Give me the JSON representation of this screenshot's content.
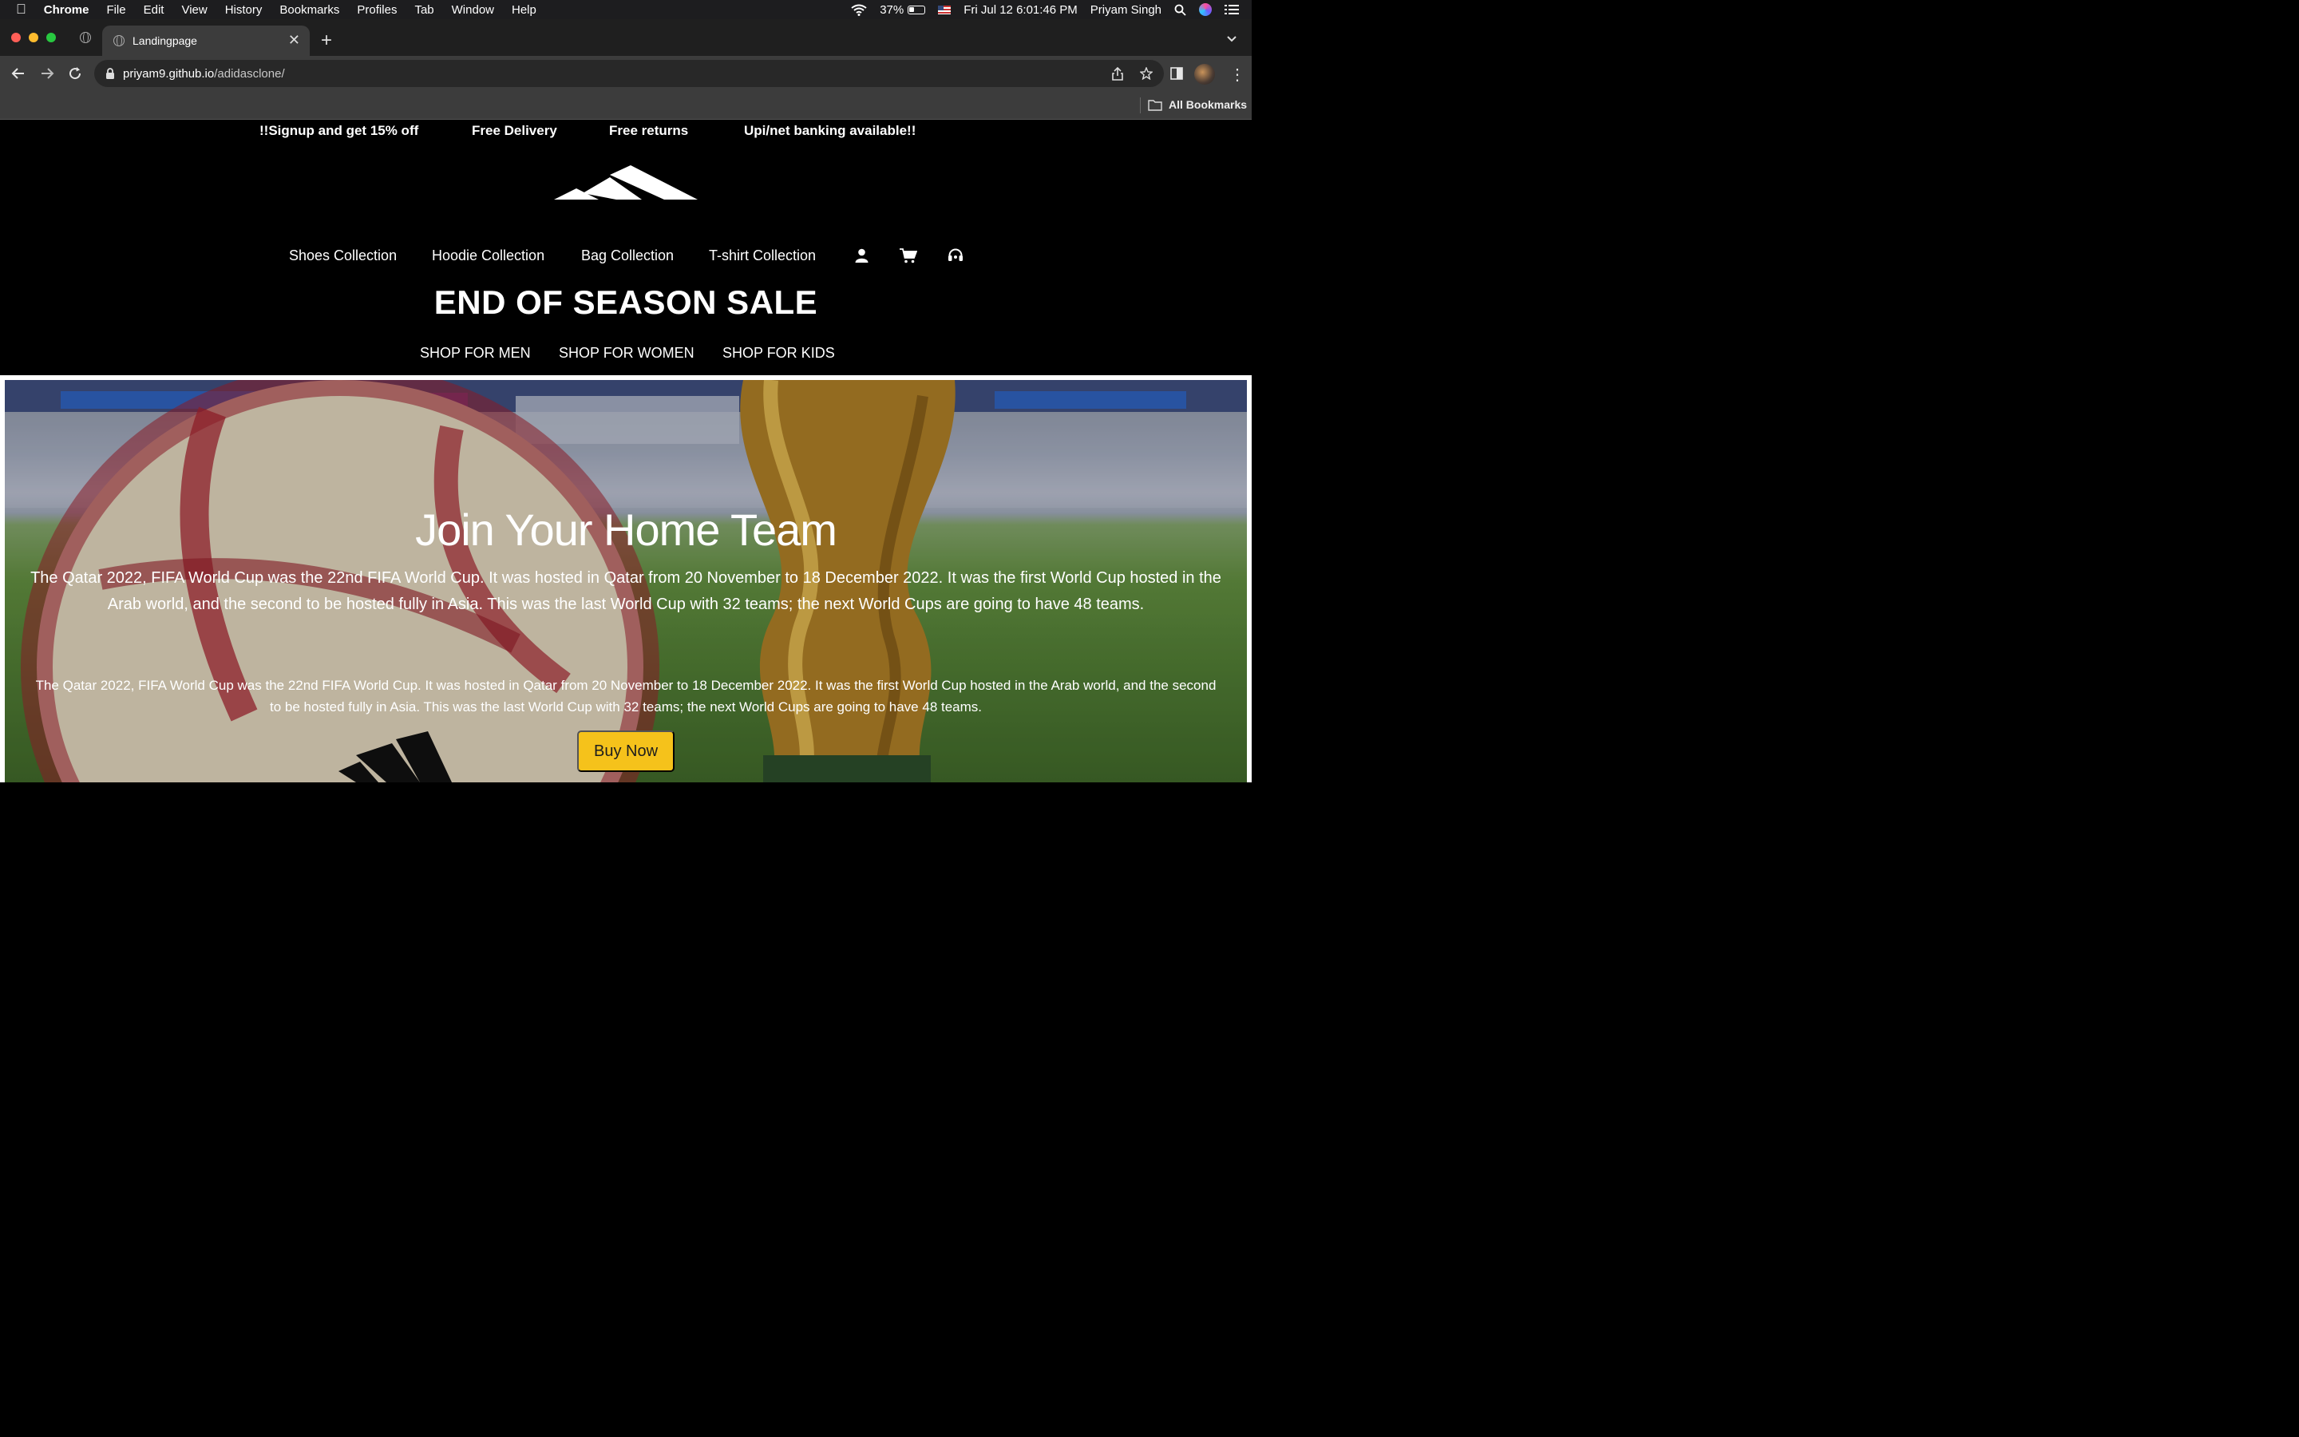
{
  "menubar": {
    "app_name": "Chrome",
    "menus": [
      "File",
      "Edit",
      "View",
      "History",
      "Bookmarks",
      "Profiles",
      "Tab",
      "Window",
      "Help"
    ],
    "battery": "37%",
    "datetime": "Fri Jul 12  6:01:46 PM",
    "user": "Priyam Singh"
  },
  "browser": {
    "tab_title": "Landingpage",
    "url_host": "priyam9.github.io",
    "url_path": "/adidasclone/",
    "bookmarks_label": "All Bookmarks"
  },
  "page": {
    "promo": [
      "!!Signup and get 15% off",
      "Free Delivery",
      "Free returns",
      "Upi/net banking available!!"
    ],
    "nav": [
      "Shoes Collection",
      "Hoodie Collection",
      "Bag Collection",
      "T-shirt Collection"
    ],
    "sale_title": "END OF SEASON SALE",
    "shop": [
      "SHOP FOR MEN",
      "SHOP FOR WOMEN",
      "SHOP FOR KIDS"
    ],
    "hero": {
      "title": "Join Your Home Team",
      "paragraph_1": "The Qatar 2022, FIFA World Cup was the 22nd FIFA World Cup. It was hosted in Qatar from 20 November to 18 December 2022. It was the first World Cup hosted in the Arab world, and the second to be hosted fully in Asia. This was the last World Cup with 32 teams; the next World Cups are going to have 48 teams.",
      "paragraph_2": "The Qatar 2022, FIFA World Cup was the 22nd FIFA World Cup. It was hosted in Qatar from 20 November to 18 December 2022. It was the first World Cup hosted in the Arab world, and the second to be hosted fully in Asia. This was the last World Cup with 32 teams; the next World Cups are going to have 48 teams.",
      "button": "Buy Now"
    }
  },
  "colors": {
    "page_bg": "#000000",
    "button_bg": "#f5c21b",
    "chrome_toolbar": "#3c3c3c"
  }
}
